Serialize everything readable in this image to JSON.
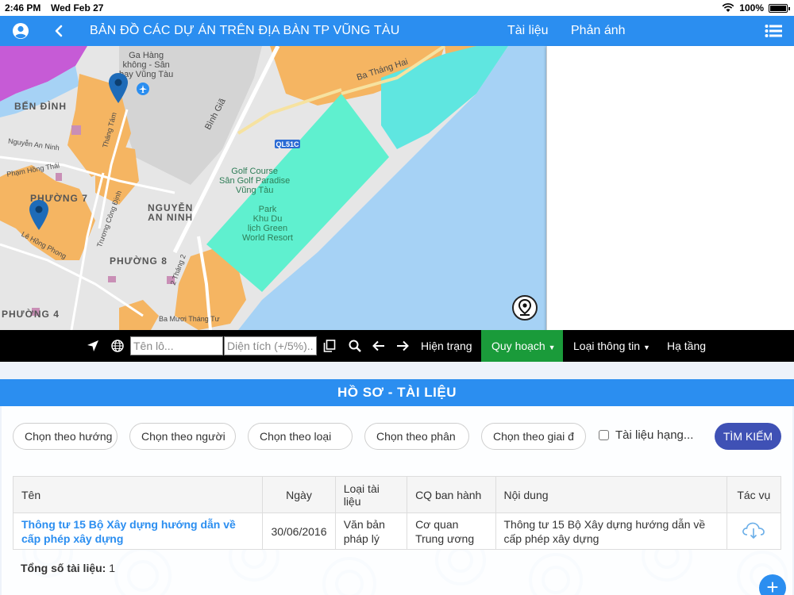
{
  "status_bar": {
    "time": "2:46 PM",
    "date": "Wed Feb 27",
    "battery": "100%"
  },
  "header": {
    "title": "BẢN ĐỒ CÁC DỰ ÁN TRÊN ĐỊA BÀN TP VŨNG TÀU",
    "nav": [
      "Tài liệu",
      "Phản ánh"
    ]
  },
  "map": {
    "labels": {
      "ga_hang": "Ga Hàng\nkhông - Sân\nbay Vũng Tàu",
      "ben_dinh": "BẾN ĐÌNH",
      "ba_thang_hai": "Ba Tháng Hai",
      "binh_gia": "Bình Giã",
      "golf": "Golf Course\nSân Golf Paradise\nVũng Tàu",
      "park": "Park\nKhu Du\nlịch Green\nWorld Resort",
      "nguyen_an_ninh": "NGUYỄN\nAN NINH",
      "phuong_7": "PHƯỜNG 7",
      "phuong_8": "PHƯỜNG 8",
      "phuong_4": "PHƯỜNG 4",
      "ql51c": "QL51C",
      "nguyen_an_ninh_st": "Nguyễn An Ninh",
      "pham_hong_thai": "Phạm Hồng Thái",
      "le_hong_phong": "Lê Hồng Phong",
      "truong_cong_dinh": "Trương Công Định",
      "thang_tam": "Tháng Tám",
      "ba_muoi_thang_tu": "Ba Mươi Tháng Tư",
      "hai_thang_hai": "2 Tháng 2"
    }
  },
  "toolbar": {
    "lot_placeholder": "Tên lô...",
    "area_placeholder": "Diện tích (+/5%)...",
    "tabs": [
      "Hiện trạng",
      "Quy hoạch",
      "Loại thông tin",
      "Hạ tầng"
    ],
    "active_tab": "Quy hoạch"
  },
  "documents": {
    "section_title": "HỒ SƠ - TÀI LIỆU",
    "filters": [
      "Chọn theo hướng",
      "Chọn theo người",
      "Chọn theo loại",
      "Chọn theo phân",
      "Chọn theo giai đ"
    ],
    "checkbox_label": "Tài liệu hạng...",
    "search_button": "TÌM KIẾM",
    "columns": [
      "Tên",
      "Ngày",
      "Loại tài liệu",
      "CQ ban hành",
      "Nội dung",
      "Tác vụ"
    ],
    "rows": [
      {
        "name": "Thông tư 15 Bộ Xây dựng hướng dẫn về cấp phép xây dựng",
        "date": "30/06/2016",
        "type": "Văn bản pháp lý",
        "issuer": "Cơ quan Trung ương",
        "content": "Thông tư 15 Bộ Xây dựng hướng dẫn về cấp phép xây dựng"
      }
    ],
    "total_label": "Tổng số tài liệu:",
    "total_value": "1"
  },
  "colors": {
    "header": "#2b8ef0",
    "active_tab": "#1a9b3a",
    "search_button": "#3f51b5",
    "link": "#2b8ef0"
  },
  "icons": [
    "user-icon",
    "back-icon",
    "list-menu-icon",
    "navigate-icon",
    "globe-icon",
    "copy-icon",
    "search-icon",
    "arrow-left-icon",
    "arrow-right-icon",
    "locate-pin-icon",
    "cloud-download-icon",
    "plus-icon",
    "map-pin-icon"
  ]
}
